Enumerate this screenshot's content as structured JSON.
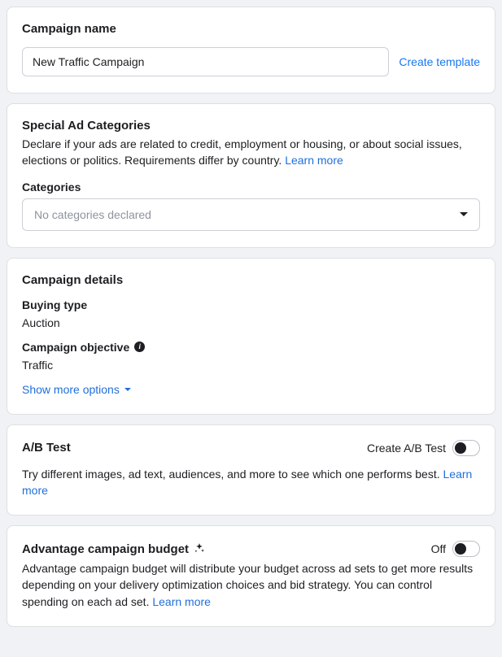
{
  "campaign_name": {
    "title": "Campaign name",
    "value": "New Traffic Campaign",
    "create_template": "Create template"
  },
  "special_ad": {
    "title": "Special Ad Categories",
    "desc": "Declare if your ads are related to credit, employment or housing, or about social issues, elections or politics. Requirements differ by country. ",
    "learn_more": "Learn more",
    "categories_label": "Categories",
    "categories_placeholder": "No categories declared"
  },
  "details": {
    "title": "Campaign details",
    "buying_type_label": "Buying type",
    "buying_type_value": "Auction",
    "objective_label": "Campaign objective",
    "objective_value": "Traffic",
    "show_more": "Show more options"
  },
  "ab_test": {
    "title": "A/B Test",
    "create_label": "Create A/B Test",
    "desc": "Try different images, ad text, audiences, and more to see which one performs best. ",
    "learn_more": "Learn more"
  },
  "advantage": {
    "title": "Advantage campaign budget",
    "state": "Off",
    "desc": "Advantage campaign budget will distribute your budget across ad sets to get more results depending on your delivery optimization choices and bid strategy. You can control spending on each ad set. ",
    "learn_more": "Learn more"
  }
}
